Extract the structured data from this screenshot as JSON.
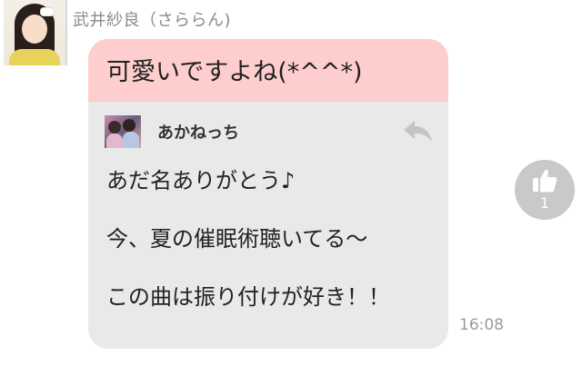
{
  "sender": {
    "name": "武井紗良（さららん)"
  },
  "message": {
    "main_text": "可愛いですよね(*^^*)",
    "quote_author": "あかねっち",
    "quote_body": "あだ名ありがとう♪\n\n今、夏の催眠術聴いてる〜\n\nこの曲は振り付けが好き！！",
    "timestamp": "16:08"
  },
  "like": {
    "count": "1"
  },
  "icons": {
    "reply": "reply-arrow-icon",
    "like": "thumbs-up-icon"
  },
  "colors": {
    "bubble_header": "#fecdcd",
    "bubble_body": "#e9e9e9",
    "like_button": "#c9c9c9"
  }
}
